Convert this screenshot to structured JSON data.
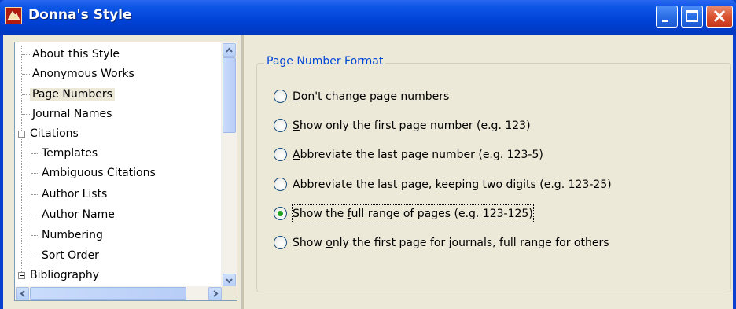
{
  "window": {
    "title": "Donna's Style"
  },
  "tree": {
    "items": [
      {
        "label": "About this Style"
      },
      {
        "label": "Anonymous Works"
      },
      {
        "label": "Page Numbers",
        "selected": true
      },
      {
        "label": "Journal Names"
      },
      {
        "label": "Citations",
        "expanded": true
      },
      {
        "label": "Templates"
      },
      {
        "label": "Ambiguous Citations"
      },
      {
        "label": "Author Lists"
      },
      {
        "label": "Author Name"
      },
      {
        "label": "Numbering"
      },
      {
        "label": "Sort Order"
      },
      {
        "label": "Bibliography",
        "expanded": true
      }
    ]
  },
  "group": {
    "legend": "Page Number Format",
    "options": [
      {
        "pre": "",
        "key": "D",
        "post": "on't change page numbers",
        "checked": false
      },
      {
        "pre": "",
        "key": "S",
        "post": "how only the first page number (e.g. 123)",
        "checked": false
      },
      {
        "pre": "",
        "key": "A",
        "post": "bbreviate the last page number (e.g. 123-5)",
        "checked": false
      },
      {
        "pre": "Abbreviate the last page, ",
        "key": "k",
        "post": "eeping two digits (e.g. 123-25)",
        "checked": false
      },
      {
        "pre": "Show the ",
        "key": "f",
        "post": "ull range of pages (e.g. 123-125)",
        "checked": true
      },
      {
        "pre": "Show ",
        "key": "o",
        "post": "nly the first page for journals, full range for others",
        "checked": false
      }
    ]
  },
  "icons": {
    "app": "app-icon",
    "minimize": "minimize-icon",
    "maximize": "maximize-icon",
    "close": "close-icon"
  }
}
